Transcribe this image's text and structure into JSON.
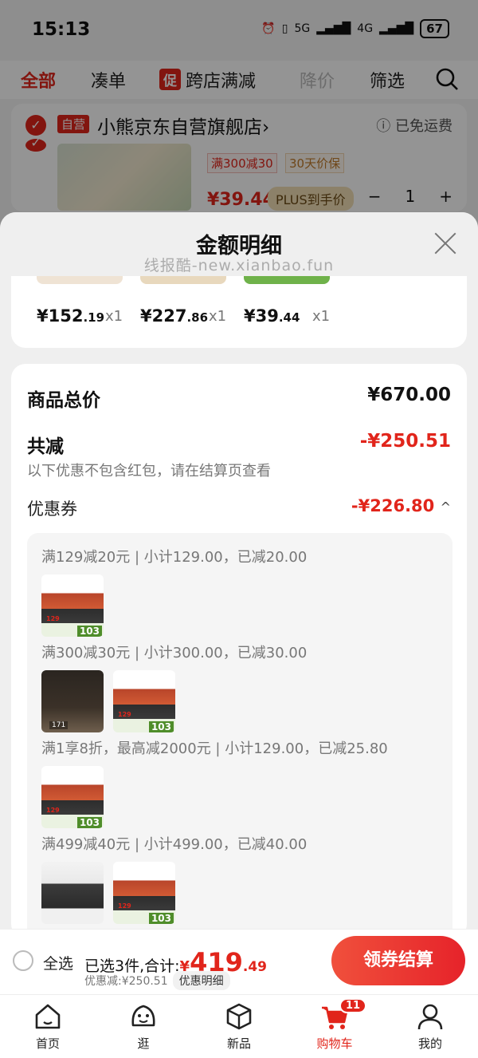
{
  "status": {
    "time": "15:13",
    "net1": "5G",
    "net2": "4G",
    "battery": "67"
  },
  "filter_tabs": [
    {
      "label": "全部"
    },
    {
      "label": "凑单"
    },
    {
      "badge": "促",
      "label": "跨店满减"
    },
    {
      "label": "降价"
    },
    {
      "label": "筛选"
    }
  ],
  "store": {
    "badge": "自营",
    "name": "小熊京东自营旗舰店",
    "chevron": "›",
    "free_shipping": "已免运费",
    "tags": [
      "满300减30",
      "30天价保"
    ],
    "price": "¥39.44",
    "plus_label": "PLUS到手价",
    "qty": "1",
    "minus": "−",
    "plus": "+"
  },
  "modal": {
    "title": "金额明细",
    "watermark": "线报酷-new.xianbao.fun",
    "items": [
      {
        "price_int": "¥152",
        "price_dec": ".19",
        "qty": "x1"
      },
      {
        "price_int": "¥227",
        "price_dec": ".86",
        "qty": "x1"
      },
      {
        "price_int": "¥39",
        "price_dec": ".44",
        "qty": "x1"
      }
    ],
    "subtotal_label": "商品总价",
    "subtotal_value": "¥670.00",
    "discount_label": "共减",
    "discount_value": "-¥250.51",
    "discount_note": "以下优惠不包含红包，请在结算页查看",
    "coupon_label": "优惠券",
    "coupon_value": "-¥226.80",
    "coupon_chevron": "^",
    "coupon_lines": [
      "满129减20元 | 小计129.00，已减20.00",
      "满300减30元 | 小计300.00，已减30.00",
      "满1享8折，最高减2000元 | 小计129.00，已减25.80",
      "满499减40元 | 小计499.00，已减40.00"
    ],
    "img_texts": {
      "p103": "103",
      "p129": "129",
      "b171": "171"
    }
  },
  "checkout": {
    "select_all": "全选",
    "summary_prefix": "已选3件,合计:",
    "total_yen": "¥",
    "total_int": "419",
    "total_dec": ".49",
    "discount_text": "优惠减:¥250.51",
    "detail_btn": "优惠明细",
    "pay_btn": "领券结算"
  },
  "nav": [
    {
      "label": "首页"
    },
    {
      "label": "逛"
    },
    {
      "label": "新品"
    },
    {
      "label": "购物车",
      "badge": "11"
    },
    {
      "label": "我的"
    }
  ],
  "colors": {
    "accent": "#e1251b",
    "plus_gold": "#f2dfb5"
  }
}
